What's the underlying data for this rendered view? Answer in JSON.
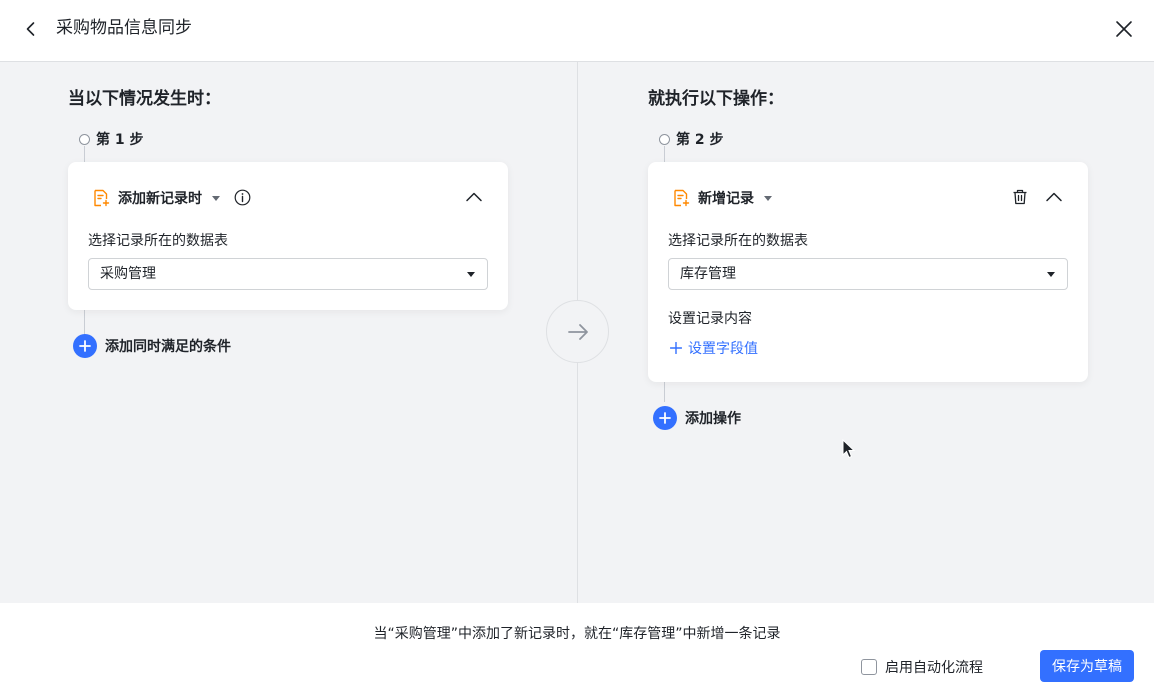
{
  "header": {
    "title": "采购物品信息同步"
  },
  "trigger": {
    "heading": "当以下情况发生时：",
    "step_label": "第 1 步",
    "card": {
      "title": "添加新记录时",
      "field_label": "选择记录所在的数据表",
      "table_value": "采购管理"
    },
    "add_condition_label": "添加同时满足的条件"
  },
  "action": {
    "heading": "就执行以下操作：",
    "step_label": "第 2 步",
    "card": {
      "title": "新增记录",
      "field_label": "选择记录所在的数据表",
      "table_value": "库存管理",
      "record_content_label": "设置记录内容",
      "set_field_link": "设置字段值"
    },
    "add_action_label": "添加操作"
  },
  "footer": {
    "summary": "当“采购管理”中添加了新记录时，就在“库存管理”中新增一条记录",
    "enable_label": "启用自动化流程",
    "save_button": "保存为草稿"
  },
  "colors": {
    "accent": "#3370ff",
    "canvas_bg": "#f2f3f5",
    "card_icon": "#ff8800"
  },
  "icons": {
    "back": "chevron-left-icon",
    "close": "close-icon",
    "flow_arrow": "arrow-right-icon",
    "trigger": "record-add-icon",
    "info": "info-icon",
    "collapse": "chevron-up-icon",
    "delete": "trash-icon",
    "plus": "plus-icon"
  }
}
